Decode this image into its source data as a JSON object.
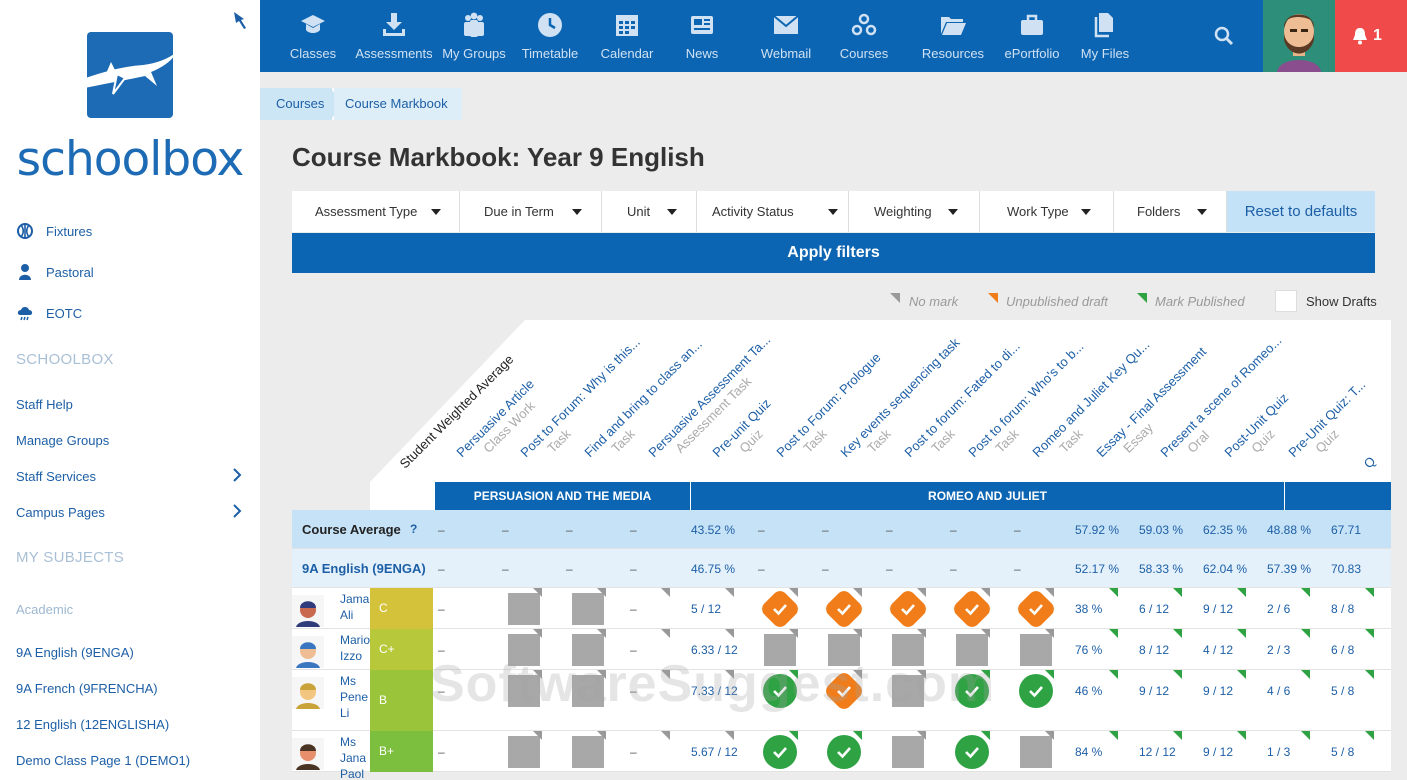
{
  "sidebar": {
    "brand": "schoolbox",
    "links": [
      {
        "label": "Fixtures",
        "icon": "basketball-icon"
      },
      {
        "label": "Pastoral",
        "icon": "person-icon"
      },
      {
        "label": "EOTC",
        "icon": "weather-icon"
      }
    ],
    "section1": "SCHOOLBOX",
    "section1_items": [
      {
        "label": "Staff Help",
        "chevron": false
      },
      {
        "label": "Manage Groups",
        "chevron": false
      },
      {
        "label": "Staff Services",
        "chevron": true
      },
      {
        "label": "Campus Pages",
        "chevron": true
      }
    ],
    "section2": "MY SUBJECTS",
    "subheading": "Academic",
    "subjects": [
      "9A English (9ENGA)",
      "9A French (9FRENCHA)",
      "12 English (12ENGLISHA)",
      "Demo Class Page 1 (DEMO1)"
    ]
  },
  "nav": [
    {
      "label": "Classes",
      "icon": "graduation-cap-icon"
    },
    {
      "label": "Assessments",
      "icon": "download-tray-icon"
    },
    {
      "label": "My Groups",
      "icon": "group-icon"
    },
    {
      "label": "Timetable",
      "icon": "clock-icon"
    },
    {
      "label": "Calendar",
      "icon": "calendar-icon"
    },
    {
      "label": "News",
      "icon": "newspaper-icon"
    },
    {
      "label": "Webmail",
      "icon": "envelope-icon"
    },
    {
      "label": "Courses",
      "icon": "courses-icon"
    },
    {
      "label": "Resources",
      "icon": "folder-open-icon"
    },
    {
      "label": "ePortfolio",
      "icon": "briefcase-icon"
    },
    {
      "label": "My Files",
      "icon": "files-icon"
    }
  ],
  "notifications": {
    "count": "1"
  },
  "breadcrumb": [
    "Courses",
    "Course Markbook"
  ],
  "page_title": "Course Markbook: Year 9 English",
  "filters": [
    "Assessment Type",
    "Due in Term",
    "Unit",
    "Activity Status",
    "Weighting",
    "Work Type",
    "Folders"
  ],
  "reset_label": "Reset to defaults",
  "apply_label": "Apply filters",
  "legend": {
    "no_mark": "No mark",
    "unpublished": "Unpublished draft",
    "published": "Mark Published",
    "show_drafts": "Show Drafts"
  },
  "colors": {
    "no_mark": "#999999",
    "unpublished": "#f07d1a",
    "published": "#2fa343",
    "brand": "#0c65b3"
  },
  "columns": [
    {
      "title": "Student Weighted Average",
      "type": ""
    },
    {
      "title": "Persuasive Article",
      "type": "Class Work"
    },
    {
      "title": "Post to Forum: Why is this...",
      "type": "Task"
    },
    {
      "title": "Find and bring to class an...",
      "type": "Task"
    },
    {
      "title": "Persuasive Assessment Ta...",
      "type": "Assessment Task"
    },
    {
      "title": "Pre-unit Quiz",
      "type": "Quiz"
    },
    {
      "title": "Post to Forum: Prologue",
      "type": "Task"
    },
    {
      "title": "Key events sequencing task",
      "type": "Task"
    },
    {
      "title": "Post to forum: Fated to di...",
      "type": "Task"
    },
    {
      "title": "Post to forum: Who's to b...",
      "type": "Task"
    },
    {
      "title": "Romeo and Juliet Key Qu...",
      "type": "Task"
    },
    {
      "title": "Essay - Final Assessment",
      "type": "Essay"
    },
    {
      "title": "Present a scene of Romeo...",
      "type": "Oral"
    },
    {
      "title": "Post-Unit Quiz",
      "type": "Quiz"
    },
    {
      "title": "Pre-Unit Quiz: T...",
      "type": "Quiz"
    },
    {
      "title": "Q",
      "type": ""
    }
  ],
  "units": [
    "PERSUASION AND THE MEDIA",
    "ROMEO AND JULIET",
    ""
  ],
  "course_average": {
    "label": "Course Average",
    "help": "?",
    "values": [
      "–",
      "–",
      "–",
      "–",
      "43.52 %",
      "–",
      "–",
      "–",
      "–",
      "–",
      "57.92 %",
      "59.03 %",
      "62.35 %",
      "48.88 %",
      "67.71"
    ]
  },
  "class_average": {
    "label": "9A English (9ENGA)",
    "values": [
      "–",
      "–",
      "–",
      "–",
      "46.75 %",
      "–",
      "–",
      "–",
      "–",
      "–",
      "52.17 %",
      "58.33 %",
      "62.04 %",
      "57.39 %",
      "70.83"
    ]
  },
  "students": [
    {
      "name": [
        "Jama",
        "Ali"
      ],
      "grade": "C",
      "grade_color": "#d4c23a",
      "cells": [
        {
          "t": "text",
          "v": "–"
        },
        {
          "t": "grey"
        },
        {
          "t": "grey"
        },
        {
          "t": "text",
          "v": "–"
        },
        {
          "t": "text",
          "v": "5 / 12"
        },
        {
          "t": "orange"
        },
        {
          "t": "orange"
        },
        {
          "t": "orange"
        },
        {
          "t": "orange"
        },
        {
          "t": "orange"
        },
        {
          "t": "text",
          "v": "38 %"
        },
        {
          "t": "text",
          "v": "6 / 12"
        },
        {
          "t": "text",
          "v": "9 / 12"
        },
        {
          "t": "text",
          "v": "2 / 6"
        },
        {
          "t": "text",
          "v": "8 / 8"
        }
      ]
    },
    {
      "name": [
        "Mario",
        "Izzo"
      ],
      "grade": "C+",
      "grade_color": "#b7c83a",
      "cells": [
        {
          "t": "text",
          "v": "–"
        },
        {
          "t": "grey"
        },
        {
          "t": "grey"
        },
        {
          "t": "text",
          "v": "–"
        },
        {
          "t": "text",
          "v": "6.33 / 12"
        },
        {
          "t": "grey"
        },
        {
          "t": "grey"
        },
        {
          "t": "grey"
        },
        {
          "t": "grey"
        },
        {
          "t": "grey"
        },
        {
          "t": "text",
          "v": "76 %"
        },
        {
          "t": "text",
          "v": "8 / 12"
        },
        {
          "t": "text",
          "v": "4 / 12"
        },
        {
          "t": "text",
          "v": "2 / 3"
        },
        {
          "t": "text",
          "v": "6 / 8"
        }
      ]
    },
    {
      "name": [
        "Ms",
        "Pene",
        "Li"
      ],
      "grade": "B",
      "grade_color": "#9ac53b",
      "cells": [
        {
          "t": "text",
          "v": "–"
        },
        {
          "t": "grey"
        },
        {
          "t": "grey"
        },
        {
          "t": "text",
          "v": "–"
        },
        {
          "t": "text",
          "v": "7.33 / 12"
        },
        {
          "t": "green"
        },
        {
          "t": "orange"
        },
        {
          "t": "grey"
        },
        {
          "t": "green"
        },
        {
          "t": "green"
        },
        {
          "t": "text",
          "v": "46 %"
        },
        {
          "t": "text",
          "v": "9 / 12"
        },
        {
          "t": "text",
          "v": "9 / 12"
        },
        {
          "t": "text",
          "v": "4 / 6"
        },
        {
          "t": "text",
          "v": "5 / 8"
        }
      ]
    },
    {
      "name": [
        "Ms",
        "Jana",
        "Paol"
      ],
      "grade": "B+",
      "grade_color": "#7cbf3f",
      "cells": [
        {
          "t": "text",
          "v": "–"
        },
        {
          "t": "grey"
        },
        {
          "t": "grey"
        },
        {
          "t": "text",
          "v": "–"
        },
        {
          "t": "text",
          "v": "5.67 / 12"
        },
        {
          "t": "green"
        },
        {
          "t": "green"
        },
        {
          "t": "grey"
        },
        {
          "t": "green"
        },
        {
          "t": "grey"
        },
        {
          "t": "text",
          "v": "84 %"
        },
        {
          "t": "text",
          "v": "12 / 12"
        },
        {
          "t": "text",
          "v": "9 / 12"
        },
        {
          "t": "text",
          "v": "1 / 3"
        },
        {
          "t": "text",
          "v": "5 / 8"
        }
      ]
    }
  ],
  "watermark": "SoftwareSuggest.com"
}
